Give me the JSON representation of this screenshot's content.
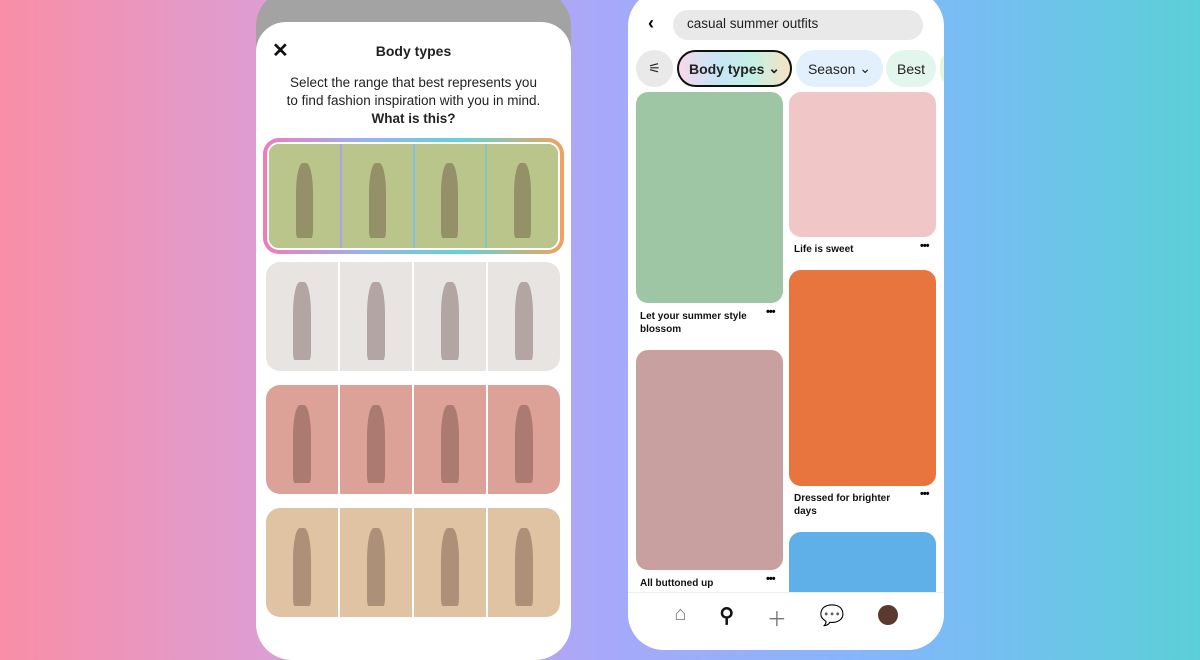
{
  "left_phone": {
    "sheet_title": "Body types",
    "description": "Select the range that best represents you to find fashion inspiration with you in mind.",
    "what_link": "What is this?",
    "rows": [
      {
        "color": "#b9c58a",
        "selected": true
      },
      {
        "color": "#e8e4e2",
        "selected": false
      },
      {
        "color": "#dca298",
        "selected": false
      },
      {
        "color": "#dfc3a3",
        "selected": false
      }
    ]
  },
  "right_phone": {
    "search_value": "casual summer outfits",
    "chips": [
      "Body types",
      "Season",
      "Best"
    ],
    "pins": [
      {
        "caption": "Let your summer style blossom",
        "color": "#9fc6a4"
      },
      {
        "caption": "All buttoned up",
        "color": "#c9a0a0"
      },
      {
        "caption": "Life is sweet",
        "color": "#f0c6c6"
      },
      {
        "caption": "Dressed for brighter days",
        "color": "#e8743e"
      },
      {
        "caption": "",
        "color": "#5fb0e8"
      }
    ],
    "nav": [
      "home-icon",
      "search-icon",
      "plus-icon",
      "chat-icon",
      "profile-avatar"
    ]
  }
}
